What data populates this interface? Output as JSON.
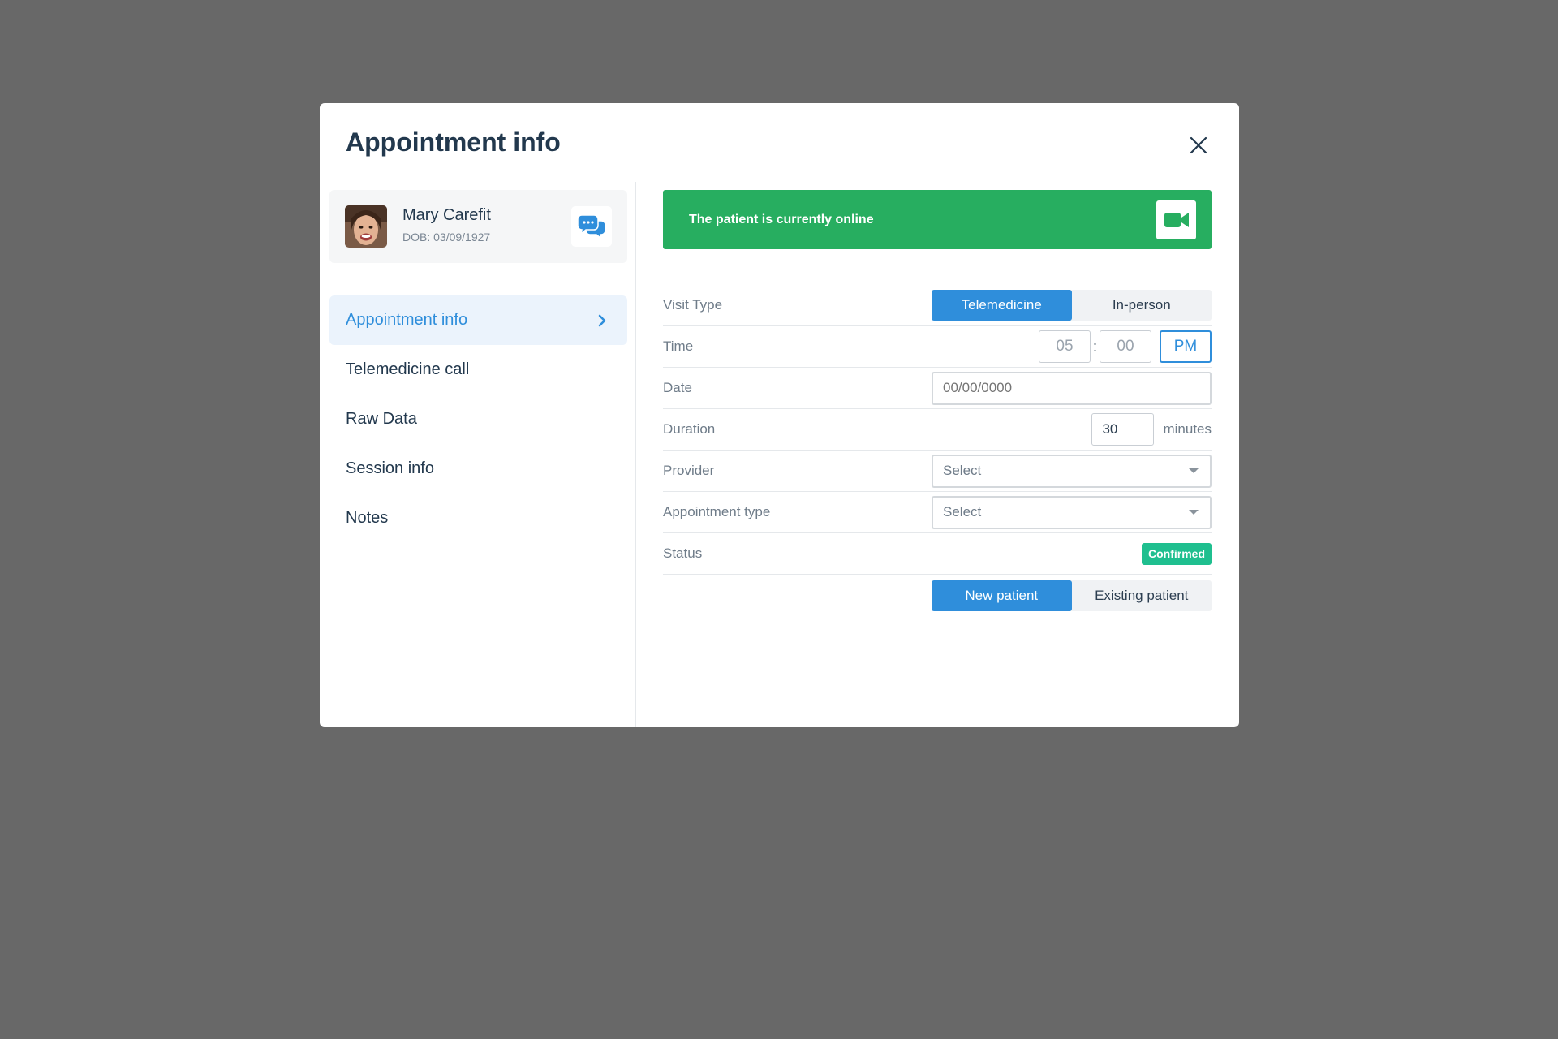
{
  "modal": {
    "title": "Appointment info"
  },
  "patient": {
    "name": "Mary Carefit",
    "dob": "DOB: 03/09/1927"
  },
  "nav": {
    "items": [
      {
        "label": "Appointment info",
        "active": true
      },
      {
        "label": "Telemedicine call",
        "active": false
      },
      {
        "label": "Raw Data",
        "active": false
      },
      {
        "label": "Session info",
        "active": false
      },
      {
        "label": "Notes",
        "active": false
      }
    ]
  },
  "banner": {
    "text": "The patient is currently online",
    "icon": "video-camera-icon",
    "color": "#27ae60"
  },
  "form": {
    "visit_type": {
      "label": "Visit Type",
      "options": [
        "Telemedicine",
        "In-person"
      ],
      "selected": "Telemedicine"
    },
    "time": {
      "label": "Time",
      "hour_placeholder": "05",
      "minute_placeholder": "00",
      "separator": ":",
      "ampm": "PM"
    },
    "date": {
      "label": "Date",
      "placeholder": "00/00/0000"
    },
    "duration": {
      "label": "Duration",
      "value": "30",
      "unit": "minutes"
    },
    "provider": {
      "label": "Provider",
      "value": "Select"
    },
    "appointment_type": {
      "label": "Appointment type",
      "value": "Select"
    },
    "status": {
      "label": "Status",
      "value": "Confirmed",
      "color": "#1fbf8f"
    },
    "patient_kind": {
      "options": [
        "New patient",
        "Existing patient"
      ],
      "selected": "New patient"
    }
  },
  "colors": {
    "accent": "#2f8edb",
    "overlay": "#686868"
  }
}
